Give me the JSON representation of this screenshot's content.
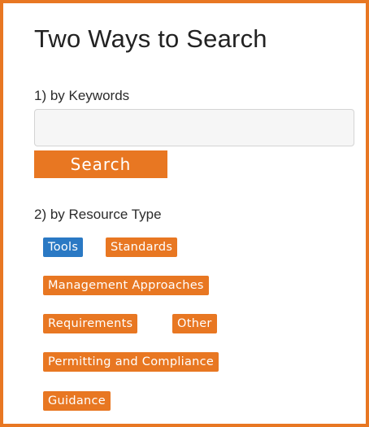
{
  "panel": {
    "title": "Two Ways to Search",
    "keywords_label": "1) by Keywords",
    "search_input": {
      "value": "",
      "placeholder": ""
    },
    "search_button_label": "Search",
    "resource_type_label": "2) by Resource Type",
    "tags": {
      "tools": "Tools",
      "standards": "Standards",
      "management": "Management Approaches",
      "requirements": "Requirements",
      "other": "Other",
      "permitting": "Permitting and Compliance",
      "guidance": "Guidance"
    },
    "active_tag": "Tools"
  },
  "colors": {
    "accent": "#e87722",
    "active_tag": "#2a79c4",
    "border": "#e87722"
  }
}
